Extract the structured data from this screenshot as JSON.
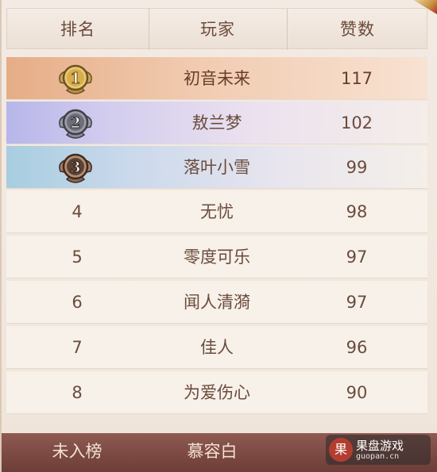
{
  "header": {
    "rank": "排名",
    "player": "玩家",
    "likes": "赞数"
  },
  "rows": [
    {
      "rank": "1",
      "player": "初音未来",
      "likes": "117",
      "style": "gold"
    },
    {
      "rank": "2",
      "player": "敖兰梦",
      "likes": "102",
      "style": "silver"
    },
    {
      "rank": "3",
      "player": "落叶小雪",
      "likes": "99",
      "style": "bronze"
    },
    {
      "rank": "4",
      "player": "无忧",
      "likes": "98"
    },
    {
      "rank": "5",
      "player": "零度可乐",
      "likes": "97"
    },
    {
      "rank": "6",
      "player": "闻人清漪",
      "likes": "97"
    },
    {
      "rank": "7",
      "player": "佳人",
      "likes": "96"
    },
    {
      "rank": "8",
      "player": "为爱伤心",
      "likes": "90"
    }
  ],
  "self": {
    "rank": "未入榜",
    "player": "慕容白"
  },
  "watermark": {
    "logo": "果",
    "name": "果盘游戏",
    "url": "guopan.cn"
  },
  "colors": {
    "gold": "#e6ad87",
    "silver": "#b7b6ea",
    "bronze": "#a8cde0",
    "footer": "#7a4841",
    "text": "#6b4b3b"
  }
}
